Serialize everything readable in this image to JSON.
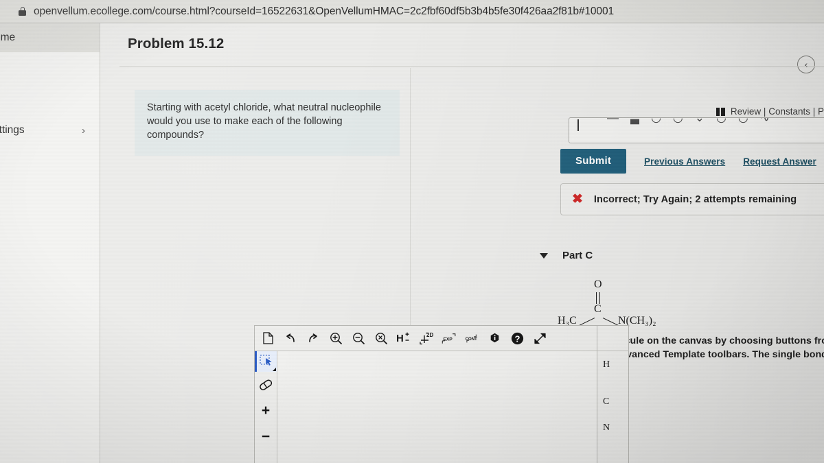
{
  "browser": {
    "lock_icon": "lock-icon",
    "url": "openvellum.ecollege.com/course.html?courseId=16522631&OpenVellumHMAC=2c2fbf60df5b3b4b5fe30f426aa2f81b#10001"
  },
  "sidebar": {
    "items": [
      {
        "label": "ome",
        "icon": "",
        "chevron": ""
      },
      {
        "label": "ettings",
        "icon": "",
        "chevron": "›"
      }
    ]
  },
  "header": {
    "title": "Problem 15.12",
    "back_icon": "chevron-left-icon",
    "back_glyph": "‹"
  },
  "question": {
    "text": "Starting with acetyl chloride, what neutral nucleophile would you use to make each of the following compounds?"
  },
  "review_bar": {
    "book_icon": "book-icon",
    "links": "Review | Constants | P"
  },
  "answer": {
    "field_value": "",
    "field_placeholder": "",
    "caret": "|"
  },
  "actions": {
    "submit_label": "Submit",
    "previous_answers_label": "Previous Answers",
    "request_answer_label": "Request Answer"
  },
  "feedback": {
    "icon": "x-mark-icon",
    "icon_glyph": "✖",
    "text": "Incorrect; Try Again; 2 attempts remaining",
    "color": "#cf2222"
  },
  "part": {
    "toggle_icon": "triangle-down-icon",
    "label": "Part C"
  },
  "molecule": {
    "name": "N,N-dimethylacetamide",
    "atoms": [
      {
        "label": "O",
        "sub": ""
      },
      {
        "label": "C",
        "sub": ""
      },
      {
        "label": "H",
        "sub": "3"
      },
      {
        "label": "C",
        "sub": ""
      },
      {
        "label": "N(CH",
        "sub": "3"
      },
      {
        "label": ")",
        "sub": "2"
      }
    ],
    "left_group": "H₃C",
    "center_atom": "C",
    "top_atom": "O",
    "right_group": "N(CH₃)₂"
  },
  "instructions": {
    "text": "Draw the molecule on the canvas by choosing buttons from the Tools (for bonds, Atoms, and Advanced Template toolbars. The single bond is active by default.",
    "line1": "Draw the molecule on the canvas by choosing buttons from the Tools (for bond",
    "line2": "Atoms, and Advanced Template toolbars. The single bond is active by default."
  },
  "editor": {
    "toolbar": [
      {
        "name": "new-document-icon",
        "label": ""
      },
      {
        "name": "undo-icon",
        "label": ""
      },
      {
        "name": "redo-icon",
        "label": ""
      },
      {
        "name": "zoom-in-icon",
        "label": ""
      },
      {
        "name": "zoom-out-icon",
        "label": ""
      },
      {
        "name": "zoom-reset-icon",
        "label": ""
      },
      {
        "name": "hydrogen-toggle-icon",
        "label": "H±"
      },
      {
        "name": "clean-2d-icon",
        "label": "2D"
      },
      {
        "name": "expand-abbrev-icon",
        "label": "EXP"
      },
      {
        "name": "contract-abbrev-icon",
        "label": "CONT"
      },
      {
        "name": "info-icon",
        "label": "i"
      },
      {
        "name": "help-icon",
        "label": "?"
      },
      {
        "name": "fullscreen-icon",
        "label": ""
      }
    ],
    "left_tools": [
      {
        "name": "selection-tool-icon",
        "label": "",
        "active": true
      },
      {
        "name": "eraser-tool-icon",
        "label": "",
        "active": false
      },
      {
        "name": "increase-charge-icon",
        "label": "+",
        "active": false
      },
      {
        "name": "decrease-charge-icon",
        "label": "−",
        "active": false
      }
    ],
    "right_tools": [
      {
        "name": "atom-h-button",
        "label": "H"
      },
      {
        "name": "atom-c-button",
        "label": "C"
      },
      {
        "name": "atom-n-button",
        "label": "N"
      }
    ]
  }
}
